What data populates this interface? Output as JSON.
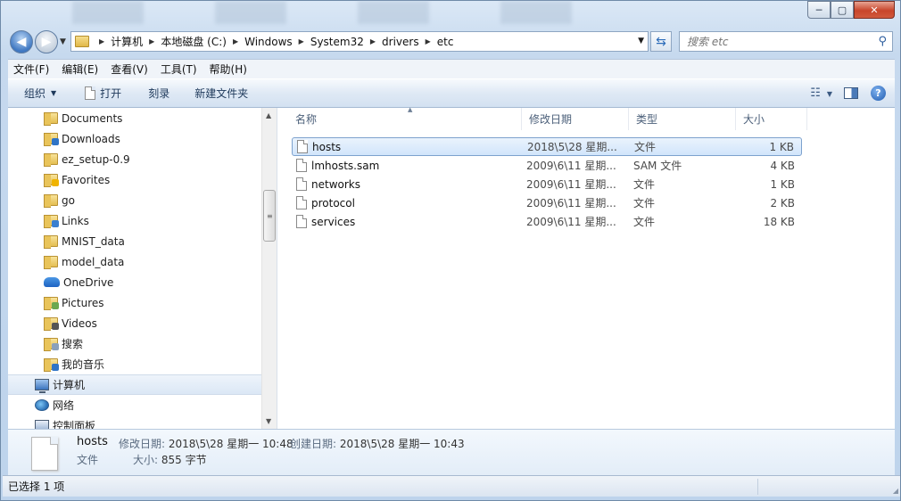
{
  "window": {
    "minimize": "─",
    "maximize": "▢",
    "close": "✕"
  },
  "address": {
    "crumbs": [
      "计算机",
      "本地磁盘 (C:)",
      "Windows",
      "System32",
      "drivers",
      "etc"
    ]
  },
  "search": {
    "placeholder": "搜索 etc"
  },
  "menu": [
    "文件(F)",
    "编辑(E)",
    "查看(V)",
    "工具(T)",
    "帮助(H)"
  ],
  "commands": {
    "organize": "组织",
    "open": "打开",
    "burn": "刻录",
    "new_folder": "新建文件夹"
  },
  "nav": {
    "items": [
      {
        "label": "Documents",
        "icon": "folder-icon"
      },
      {
        "label": "Downloads",
        "icon": "folder-download-icon"
      },
      {
        "label": "ez_setup-0.9",
        "icon": "folder-icon"
      },
      {
        "label": "Favorites",
        "icon": "folder-star-icon"
      },
      {
        "label": "go",
        "icon": "folder-icon"
      },
      {
        "label": "Links",
        "icon": "folder-link-icon"
      },
      {
        "label": "MNIST_data",
        "icon": "folder-icon"
      },
      {
        "label": "model_data",
        "icon": "folder-icon"
      },
      {
        "label": "OneDrive",
        "icon": "onedrive-icon"
      },
      {
        "label": "Pictures",
        "icon": "folder-picture-icon"
      },
      {
        "label": "Videos",
        "icon": "folder-video-icon"
      },
      {
        "label": "搜索",
        "icon": "folder-search-icon"
      },
      {
        "label": "我的音乐",
        "icon": "folder-music-icon"
      },
      {
        "label": "计算机",
        "icon": "computer-icon"
      },
      {
        "label": "网络",
        "icon": "network-icon"
      },
      {
        "label": "控制面板",
        "icon": "control-panel-icon"
      }
    ]
  },
  "columns": {
    "name": "名称",
    "date": "修改日期",
    "type": "类型",
    "size": "大小"
  },
  "files": [
    {
      "name": "hosts",
      "date": "2018\\5\\28 星期...",
      "type": "文件",
      "size": "1 KB"
    },
    {
      "name": "lmhosts.sam",
      "date": "2009\\6\\11 星期...",
      "type": "SAM 文件",
      "size": "4 KB"
    },
    {
      "name": "networks",
      "date": "2009\\6\\11 星期...",
      "type": "文件",
      "size": "1 KB"
    },
    {
      "name": "protocol",
      "date": "2009\\6\\11 星期...",
      "type": "文件",
      "size": "2 KB"
    },
    {
      "name": "services",
      "date": "2009\\6\\11 星期...",
      "type": "文件",
      "size": "18 KB"
    }
  ],
  "details": {
    "name": "hosts",
    "modified_label": "修改日期:",
    "modified_value": "2018\\5\\28 星期一 10:48",
    "created_label": "创建日期:",
    "created_value": "2018\\5\\28 星期一 10:43",
    "type": "文件",
    "size_label": "大小:",
    "size_value": "855 字节"
  },
  "status": {
    "selected": "已选择 1 项"
  }
}
